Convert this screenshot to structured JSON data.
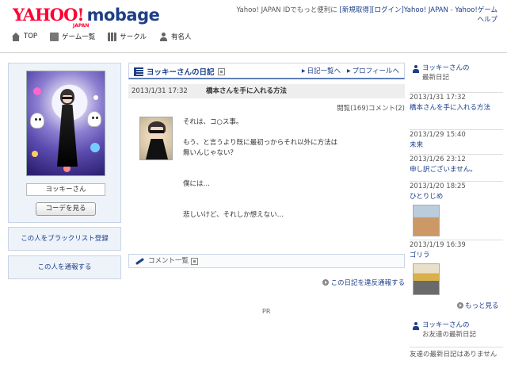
{
  "header": {
    "logo_yahoo": "YAHOO!",
    "logo_japan": "JAPAN",
    "logo_mobage": "mobage",
    "top_text": "Yahoo! JAPAN IDでもっと便利に",
    "link_register": "[新規取得]",
    "link_login": "[ログイン]",
    "link_yahoo_japan": "Yahoo! JAPAN",
    "separator": " - ",
    "link_yahoo_game": "Yahoo!ゲーム",
    "link_help": "ヘルプ"
  },
  "nav": {
    "top": "TOP",
    "games": "ゲーム一覧",
    "circle": "サークル",
    "celebrity": "有名人"
  },
  "profile": {
    "name": "ヨッキーさん",
    "coordinate_button": "コーデを見る",
    "blacklist_button": "この人をブラックリスト登録",
    "report_user_button": "この人を通報する"
  },
  "diary": {
    "title": "ヨッキーさんの日記",
    "link_diary_list": "日記一覧へ",
    "link_profile": "プロフィールへ",
    "entry_date": "2013/1/31 17:32",
    "entry_title": "橋本さんを手に入れる方法",
    "entry_stats": "閲覧(169)コメント(2)",
    "body": {
      "p1": "それは、コ○ス事。",
      "p2": "もう、と言うより既に最初っからそれ以外に方法は無いんじゃない？",
      "p3": "僕には…",
      "p4": "悲しいけど、それしか想えない…"
    },
    "comment_list": "コメント一覧",
    "report_diary": "この日記を違反通報する",
    "pr": "PR"
  },
  "sidebar": {
    "recent_head_line1": "ヨッキーさんの",
    "recent_head_line2": "最新日記",
    "entries": [
      {
        "date": "2013/1/31 17:32",
        "title": "橋本さんを手に入れる方法"
      },
      {
        "date": "2013/1/29 15:40",
        "title": "未来"
      },
      {
        "date": "2013/1/26 23:12",
        "title": "申し訳ございません。"
      },
      {
        "date": "2013/1/20 18:25",
        "title": "ひとりじめ"
      },
      {
        "date": "2013/1/19 16:39",
        "title": "ゴリラ"
      }
    ],
    "more": "もっと見る",
    "friends_head_line1": "ヨッキーさんの",
    "friends_head_line2": "お友達の最新日記",
    "friends_empty": "友達の最新日記はありません"
  },
  "colors": {
    "link": "#1a3c8a",
    "brand_red": "#ff0033",
    "brand_blue": "#1e3f86",
    "panel_bg": "#eef3fa"
  }
}
